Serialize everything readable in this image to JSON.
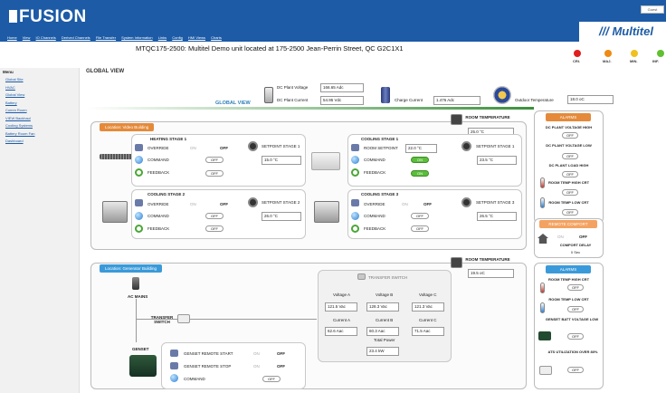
{
  "header": {
    "app_name": "FUSION",
    "brand": "Multitel",
    "user": "Guest",
    "nav": [
      "Home",
      "View",
      "IO Channels",
      "Derived Channels",
      "File Transfer",
      "System Information",
      "Links",
      "Config",
      "HMI Views",
      "Charts"
    ]
  },
  "site_title": "MTQC175-2500:  Multitel Demo unit located at 175-2500 Jean-Perrin Street, QC G2C1X1",
  "indicators": [
    {
      "label": "CRI.",
      "color": "#e02020"
    },
    {
      "label": "MAJ.",
      "color": "#f08a10"
    },
    {
      "label": "MIN.",
      "color": "#f0c020"
    },
    {
      "label": "INF.",
      "color": "#60c030"
    }
  ],
  "sidebar": {
    "title": "Menu",
    "items": [
      "Global Site",
      "HVAC",
      "Global View",
      "Battery",
      "Comm Room",
      "VIEW Backhaul",
      "Cooling Systems",
      "Battery Room Fan",
      "Dashboard"
    ]
  },
  "page_title": "GLOBAL VIEW",
  "global": {
    "label": "GLOBAL VIEW",
    "dc_voltage_label": "DC Plant Voltage",
    "dc_voltage": "166.65 Adc",
    "dc_current_label": "DC Plant Current",
    "dc_current": "54.95 Vdc",
    "charge_label": "Charge Current",
    "charge": "1.476 Adc",
    "outdoor_label": "Outdoor Temperature",
    "outdoor": "18.0 oC"
  },
  "video_bldg": {
    "tag": "Location: Video Building",
    "room_temp_label": "ROOM TEMPERATURE",
    "room_temp": "25.0 °C",
    "heat1": {
      "title": "HEATING STAGE 1",
      "override": "OVERRIDE",
      "on": "ON",
      "off": "OFF",
      "command": "COMMAND",
      "cmd": "OFF",
      "feedback": "FEEDBACK",
      "fb": "OFF",
      "sp_label": "SETPOINT STAGE 1",
      "sp": "15.0 °C"
    },
    "cool1": {
      "title": "COOLING STAGE 1",
      "room_sp_label": "ROOM SETPOINT",
      "room_sp": "22.0 °C",
      "command": "COMMAND",
      "cmd": "ON",
      "feedback": "FEEDBACK",
      "fb": "ON",
      "sp_label": "SETPOINT STAGE 1",
      "sp": "23.5 °C"
    },
    "cool2": {
      "title": "COOLING STAGE 2",
      "override": "OVERRIDE",
      "on": "ON",
      "off": "OFF",
      "command": "COMMAND",
      "cmd": "OFF",
      "feedback": "FEEDBACK",
      "fb": "OFF",
      "sp_label": "SETPOINT STAGE 2",
      "sp": "26.0 °C"
    },
    "cool3": {
      "title": "COOLING STAGE 3",
      "override": "OVERRIDE",
      "on": "ON",
      "off": "OFF",
      "command": "COMMAND",
      "cmd": "OFF",
      "feedback": "FEEDBACK",
      "fb": "OFF",
      "sp_label": "SETPOINT STAGE 3",
      "sp": "26.5 °C"
    }
  },
  "gen_bldg": {
    "tag": "Location: Generator Building",
    "room_temp_label": "ROOM TEMPERATURE",
    "room_temp": "19.5 oC",
    "ac_mains": "AC MAINS",
    "transfer": "TRANSFER SWITCH",
    "genset": "GENSET",
    "ts": {
      "title": "TRANSFER SWITCH",
      "va": "Voltage A",
      "vb": "Voltage B",
      "vc": "Voltage C",
      "va_v": "121.5 Vac",
      "vb_v": "128.3 Vac",
      "vc_v": "121.3 Vac",
      "ca": "Current A",
      "cb": "Current B",
      "cc": "Current C",
      "ca_v": "62.6 Aac",
      "cb_v": "60.3 Aac",
      "cc_v": "71.5 Aac",
      "tp": "Total Power",
      "tp_v": "23.4 kW"
    },
    "remote": {
      "start": "GENSET REMOTE START",
      "stop": "GENSET REMOTE STOP",
      "command": "COMMAND",
      "on": "ON",
      "off": "OFF",
      "cmd": "OFF"
    }
  },
  "alarms1": {
    "title": "ALARMS",
    "items": [
      {
        "label": "DC PLANT VOLTAGE HIGH",
        "state": "OFF"
      },
      {
        "label": "DC PLANT VOLTAGE LOW",
        "state": "OFF"
      },
      {
        "label": "DC PLANT LOAD HIGH",
        "state": "OFF"
      },
      {
        "label": "ROOM TEMP HIGH CRT",
        "state": "OFF"
      },
      {
        "label": "ROOM TEMP LOW CRT",
        "state": "OFF"
      }
    ]
  },
  "comfort": {
    "title": "REMOTE COMFORT",
    "on": "ON",
    "off": "OFF",
    "delay_label": "COMFORT DELAY",
    "delay": "0 Sec"
  },
  "alarms2": {
    "title": "ALARMS",
    "items": [
      {
        "label": "ROOM TEMP HIGH CRT",
        "state": "OFF"
      },
      {
        "label": "ROOM TEMP LOW CRT",
        "state": "OFF"
      },
      {
        "label": "GENSET BATT VOLTAGE LOW",
        "state": "OFF"
      },
      {
        "label": "ATS UTILIZATION OVER 80%",
        "state": "OFF"
      }
    ]
  }
}
